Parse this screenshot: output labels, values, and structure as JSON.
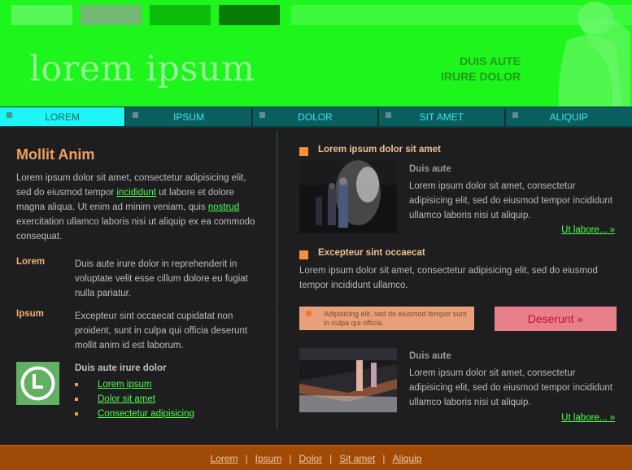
{
  "header": {
    "logo": "lorem ipsum",
    "tagline_line1": "DUIS AUTE",
    "tagline_line2": "IRURE DOLOR",
    "colors": {
      "bg": "#1df51d",
      "swatches": [
        "#55f855",
        "#72b872",
        "#0bbd0b",
        "#077a07",
        "#3ef83e"
      ]
    }
  },
  "nav": {
    "items": [
      {
        "label": "LOREM",
        "active": true
      },
      {
        "label": "IPSUM",
        "active": false
      },
      {
        "label": "DOLOR",
        "active": false
      },
      {
        "label": "SIT AMET",
        "active": false
      },
      {
        "label": "ALIQUIP",
        "active": false
      }
    ]
  },
  "left": {
    "title": "Mollit Anim",
    "intro_a": "Lorem ipsum dolor sit amet, consectetur adipisicing elit, sed do eiusmod tempor ",
    "intro_link1": "incididunt",
    "intro_b": " ut labore et dolore magna aliqua. Ut enim ad minim veniam, quis ",
    "intro_link2": "nostrud",
    "intro_c": " exercitation ullamco laboris nisi ut aliquip ex ea commodo consequat.",
    "defs": [
      {
        "term": "Lorem",
        "desc": "Duis aute irure dolor in reprehenderit in voluptate velit esse cillum dolore eu fugiat nulla pariatur."
      },
      {
        "term": "Ipsum",
        "desc": "Excepteur sint occaecat cupidatat non proident, sunt in culpa qui officia deserunt mollit anim id est laborum."
      }
    ],
    "icon": "clock-icon",
    "links_title": "Duis aute irure dolor",
    "links": [
      "Lorem ipsum",
      "Dolor sit amet",
      "Consectetur adipisicing"
    ]
  },
  "right": {
    "section1": {
      "heading": "Lorem ipsum dolor sit amet",
      "subtitle": "Duis aute",
      "text": "Lorem ipsum dolor sit amet, consectetur adipisicing elit, sed do eiusmod tempor incididunt ullamco laboris nisi ut aliquip.",
      "more": "Ut labore... »"
    },
    "section2": {
      "heading": "Excepteur sint occaecat",
      "text": "Lorem ipsum dolor sit amet, consectetur adipisicing elit, sed do eiusmod tempor incididunt ullamco."
    },
    "note": "Adipisicing elit, sed do eiusmod tempor sunt in culpa qui officia.",
    "button": "Deserunt »",
    "section3": {
      "subtitle": "Duis aute",
      "text": "Lorem ipsum dolor sit amet, consectetur adipisicing elit, sed do eiusmod tempor incididunt ullamco laboris nisi ut aliquip.",
      "more": "Ut labore... »"
    }
  },
  "footer": {
    "links": [
      "Lorem",
      "Ipsum",
      "Dolor",
      "Sit amet",
      "Aliquip"
    ],
    "separator": "|"
  }
}
